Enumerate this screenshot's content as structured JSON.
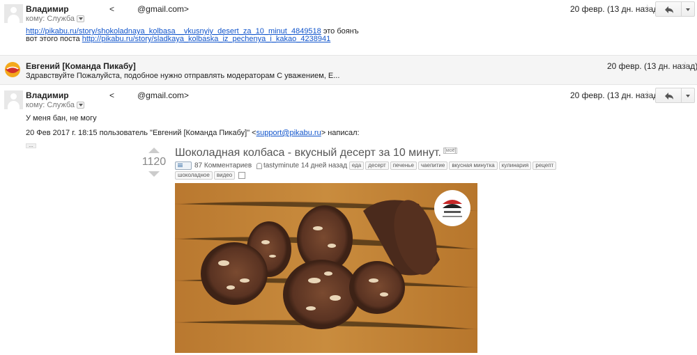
{
  "messages": [
    {
      "sender": "Владимир",
      "email_prefix": "<",
      "email_domain": "@gmail.com>",
      "to_label": "кому: Служба",
      "date": "20 февр. (13 дн. назад)",
      "body_line1_link": "http://pikabu.ru/story/shokoladnaya_kolbasa__vkusnyiy_desert_za_10_minut_4849518",
      "body_line1_suffix": " это боянъ",
      "body_line2_prefix": "вот этого поста ",
      "body_line2_link": "http://pikabu.ru/story/sladkaya_kolbaska_iz_pechenya_i_kakao_4238941"
    },
    {
      "sender": "Евгений [Команда Пикабу]",
      "snippet": "Здравствуйте Пожалуйста, подобное нужно отправлять модераторам С уважением, Е...",
      "date": "20 февр. (13 дн. назад)"
    },
    {
      "sender": "Владимир",
      "email_prefix": "<",
      "email_domain": "@gmail.com>",
      "to_label": "кому: Служба",
      "date": "20 февр. (13 дн. назад)",
      "body_line1": "У меня бан,  не могу",
      "quote_prefix": "20 Фев 2017 г. 18:15 пользователь \"Евгений [Команда Пикабу]\" <",
      "quote_email": "support@pikabu.ru",
      "quote_suffix": "> написал:",
      "ellipsis": "..."
    }
  ],
  "post": {
    "rating": "1120",
    "title": "Шоколадная колбаса - вкусный десерт за 10 минут.",
    "new_badge": "[моё]",
    "comments": "87 Комментариев",
    "author": "tastyminute",
    "age": " 14 дней назад ",
    "tags": [
      "еда",
      "десерт",
      "печенье",
      "чаепитие",
      "вкусная минутка",
      "кулинария",
      "рецепт",
      "шоколадное",
      "видео"
    ]
  },
  "icons": {
    "star": "star-icon",
    "reply": "reply-icon",
    "more": "chevron-down-icon"
  },
  "colors": {
    "link": "#1155cc",
    "collapsed_bg": "#f5f5f5"
  }
}
